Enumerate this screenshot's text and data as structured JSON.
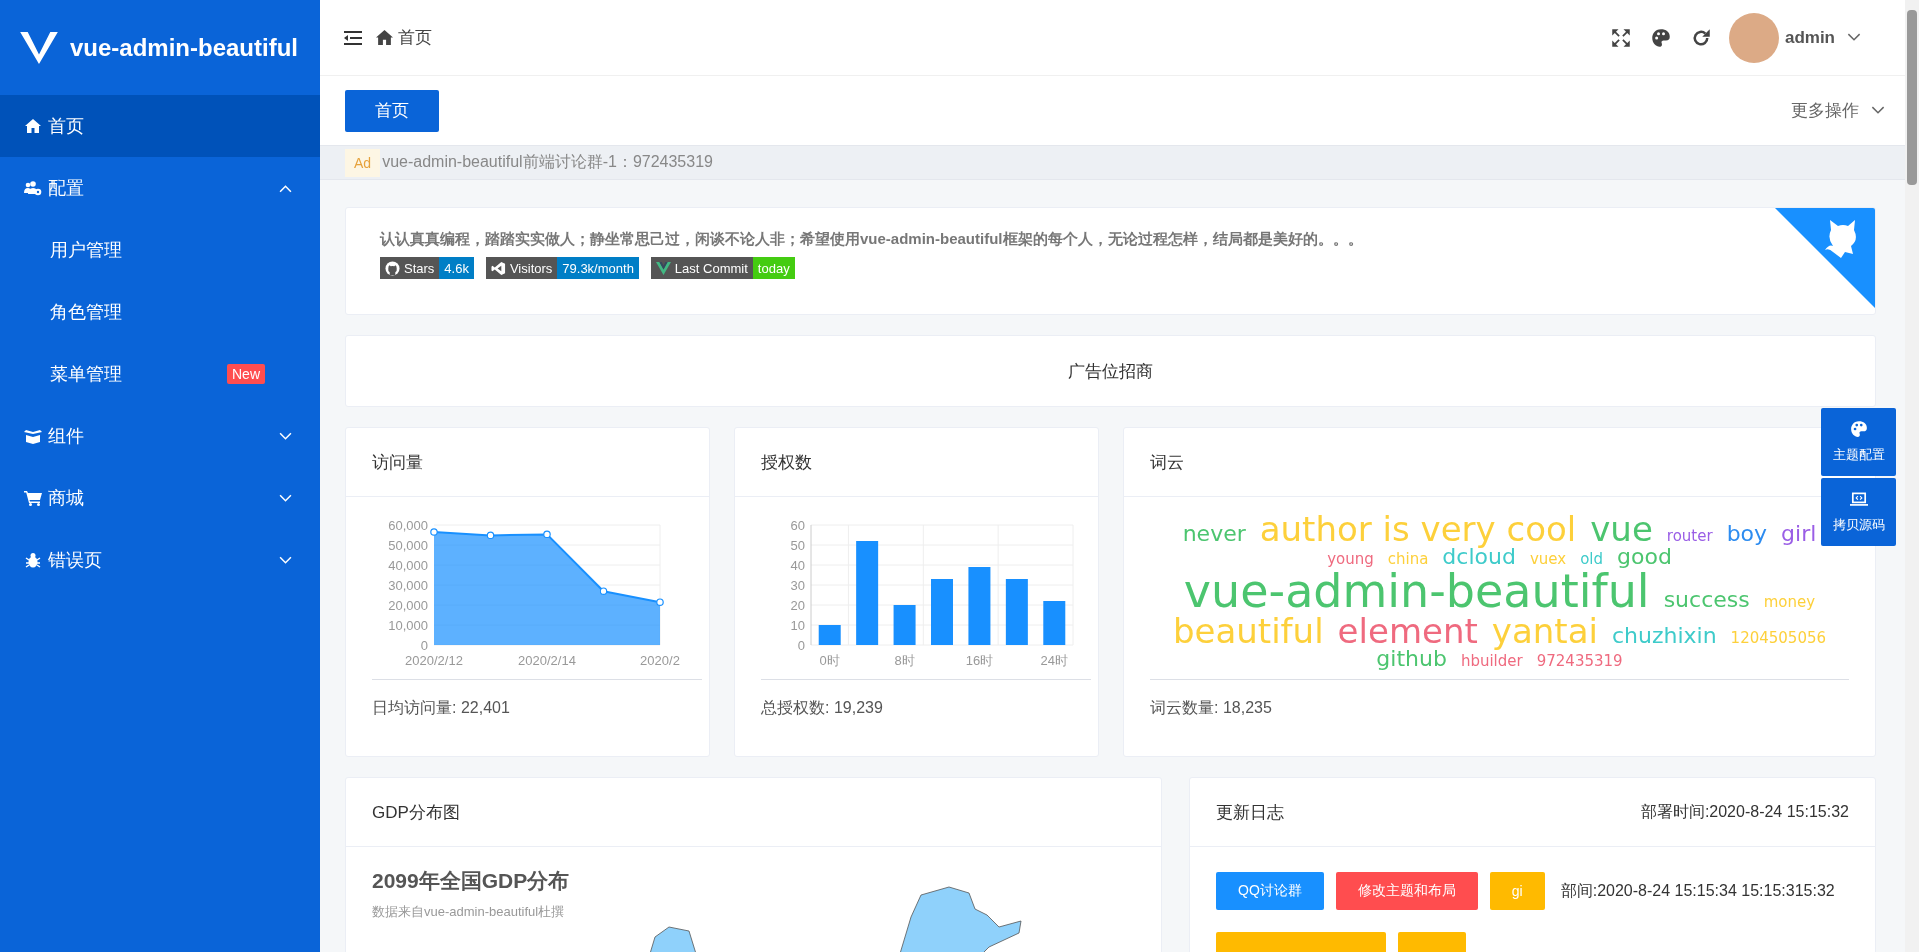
{
  "sidebar": {
    "logo": "vue-admin-beautiful",
    "items": [
      {
        "label": "首页",
        "selected": true
      },
      {
        "label": "配置",
        "selected": false,
        "expanded": true,
        "children": [
          {
            "label": "用户管理",
            "selected": false
          },
          {
            "label": "角色管理",
            "selected": false
          },
          {
            "label": "菜单管理",
            "selected": false,
            "badge": "New"
          }
        ]
      },
      {
        "label": "组件",
        "selected": false,
        "expanded": false
      },
      {
        "label": "商城",
        "selected": false,
        "expanded": false
      },
      {
        "label": "错误页",
        "selected": false,
        "expanded": false
      }
    ]
  },
  "header": {
    "breadcrumb": "首页",
    "user": "admin"
  },
  "tabs": [
    {
      "label": "首页",
      "selected": true
    }
  ],
  "more_actions": "更多操作",
  "ad_bar": {
    "tag": "Ad",
    "text": "vue-admin-beautiful前端讨论群-1：972435319"
  },
  "banner": {
    "text": "认认真真编程，踏踏实实做人；静坐常思己过，闲谈不论人非；希望使用vue-admin-beautiful框架的每个人，无论过程怎样，结局都是美好的。。。",
    "badges": [
      {
        "label": "Stars",
        "value": "4.6k",
        "color": "#007ec6"
      },
      {
        "label": "Visitors",
        "value": "79.3k/month",
        "color": "#007ec6"
      },
      {
        "label": "Last Commit",
        "value": "today",
        "color": "#44cc11"
      }
    ]
  },
  "ad_card": "广告位招商",
  "visits": {
    "title": "访问量",
    "footer": "日均访问量: 22,401",
    "chart_data": {
      "type": "area",
      "grid": true,
      "categories": [
        "2020/2/12",
        null,
        "2020/2/14",
        null,
        "2020/2"
      ],
      "series": [
        {
          "color": "#1890ff",
          "values": [
            56500,
            54800,
            55300,
            26900,
            21400
          ]
        }
      ],
      "ylim": [
        0,
        60000
      ],
      "yticks": [
        {
          "value": 0,
          "label": "0"
        },
        {
          "value": 10000,
          "label": "10,000"
        },
        {
          "value": 20000,
          "label": "20,000"
        },
        {
          "value": 30000,
          "label": "30,000"
        },
        {
          "value": 40000,
          "label": "40,000"
        },
        {
          "value": 50000,
          "label": "50,000"
        },
        {
          "value": 60000,
          "label": "60,000"
        }
      ]
    }
  },
  "auth": {
    "title": "授权数",
    "footer": "总授权数: 19,239",
    "chart_data": {
      "type": "bar",
      "grid": true,
      "categories": [
        "0时",
        null,
        "8时",
        null,
        "16时",
        null,
        "24时"
      ],
      "series": [
        {
          "color": "#1890ff",
          "values": [
            10,
            52,
            20,
            33,
            39,
            33,
            22
          ]
        }
      ],
      "ylim": [
        0,
        60
      ],
      "yticks": [
        0,
        10,
        20,
        30,
        40,
        50,
        60
      ]
    }
  },
  "wordcloud": {
    "title": "词云",
    "footer": "词云数量: 18,235",
    "words": [
      {
        "text": "never",
        "kind": "md",
        "color": "#4cc56f"
      },
      {
        "text": "author is very cool",
        "kind": "lg",
        "color": "#fdd03b"
      },
      {
        "text": "vue",
        "kind": "lg",
        "color": "#4cc56f"
      },
      {
        "text": "router",
        "kind": "sm",
        "color": "#9a5ee6"
      },
      {
        "text": "boy",
        "kind": "md",
        "color": "#2d8cf0"
      },
      {
        "text": "girl",
        "kind": "md",
        "color": "#9a5ee6"
      },
      {
        "text": "young",
        "kind": "sm",
        "color": "#ef6a7f"
      },
      {
        "text": "china",
        "kind": "sm",
        "color": "#fdd03b"
      },
      {
        "text": "dcloud",
        "kind": "md",
        "color": "#3ecbca"
      },
      {
        "text": "vuex",
        "kind": "sm",
        "color": "#fdd03b"
      },
      {
        "text": "old",
        "kind": "sm",
        "color": "#3ecbca"
      },
      {
        "text": "good",
        "kind": "md",
        "color": "#4cc56f"
      },
      {
        "text": "vue-admin-beautiful",
        "kind": "xl",
        "color": "#4cc56f"
      },
      {
        "text": "success",
        "kind": "md",
        "color": "#4cc56f"
      },
      {
        "text": "money",
        "kind": "sm",
        "color": "#fdd03b"
      },
      {
        "text": "beautiful",
        "kind": "lg",
        "color": "#fdd03b"
      },
      {
        "text": "element",
        "kind": "lg",
        "color": "#ef6a7f"
      },
      {
        "text": "yantai",
        "kind": "lg",
        "color": "#fdd03b"
      },
      {
        "text": "chuzhixin",
        "kind": "md",
        "color": "#3ecbca"
      },
      {
        "text": "1204505056",
        "kind": "sm",
        "color": "#fdd03b"
      },
      {
        "text": "github",
        "kind": "md",
        "color": "#4cc56f"
      },
      {
        "text": "hbuilder",
        "kind": "sm",
        "color": "#ef6a7f"
      },
      {
        "text": "972435319",
        "kind": "sm",
        "color": "#ef6a7f"
      }
    ]
  },
  "gdp": {
    "title": "GDP分布图",
    "map_title": "2099年全国GDP分布",
    "map_subtitle": "数据来自vue-admin-beautiful杜撰"
  },
  "changelog": {
    "title": "更新日志",
    "deploy_time": "部署时间:2020-8-24 15:15:32",
    "overlay_text": "部间:2020-8-24 15:15:34 15:15:315:32",
    "buttons": [
      {
        "label": "QQ讨论群",
        "color": "#1890ff"
      },
      {
        "label": "修改主题和布局",
        "color": "#ff4d4f"
      },
      {
        "label": "gi",
        "color": "#ffba00"
      }
    ]
  },
  "side_panel": [
    "主题配置",
    "拷贝源码"
  ]
}
